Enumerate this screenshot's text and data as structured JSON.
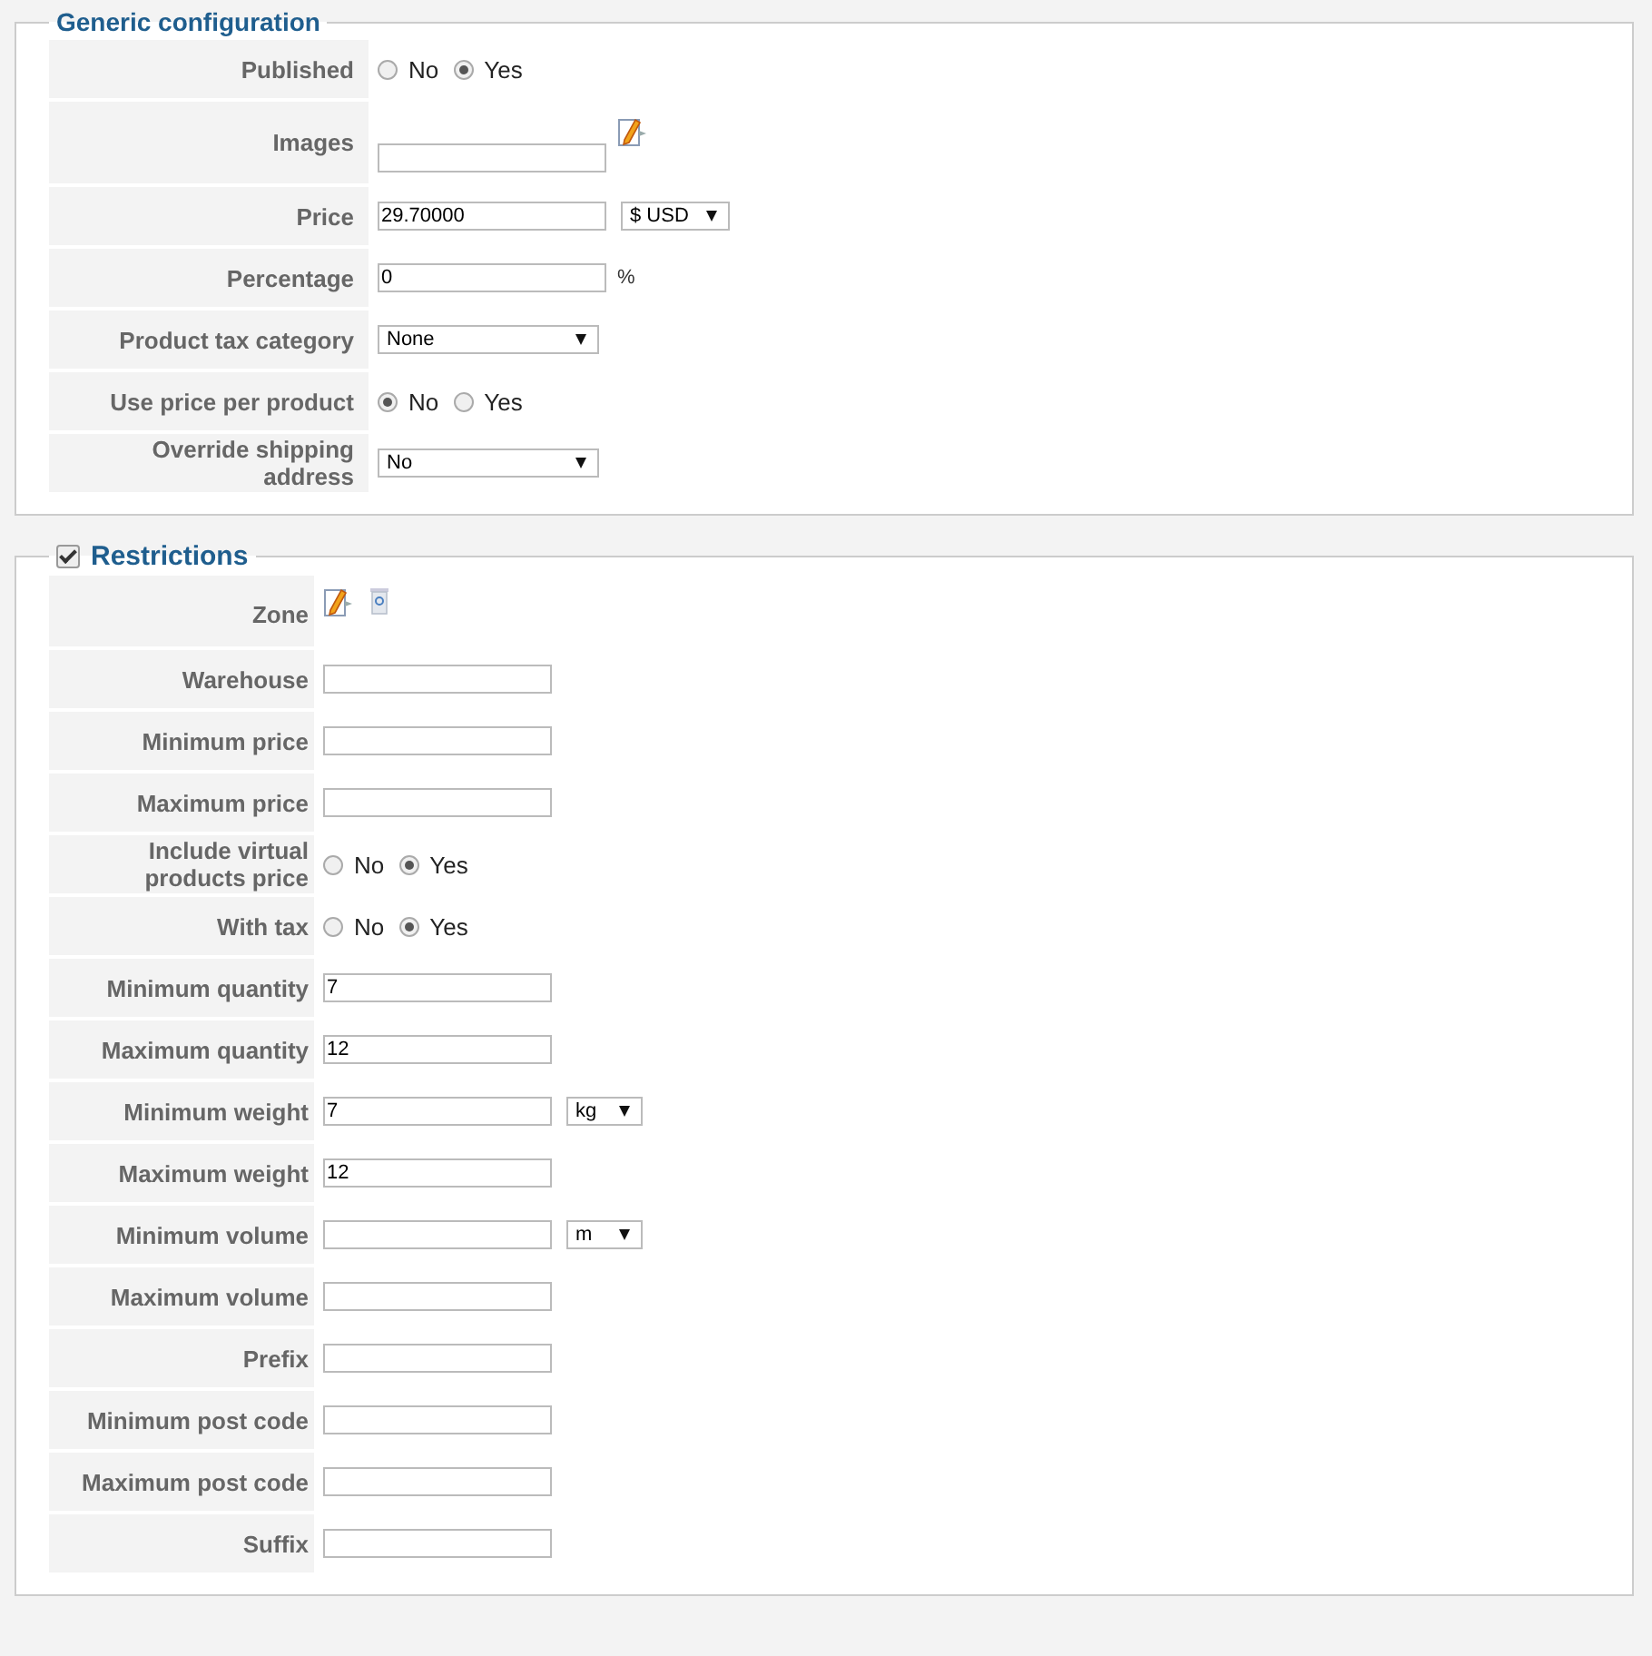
{
  "sections": [
    {
      "title": "Generic configuration",
      "fields": [
        {
          "kind": "radio",
          "label": "Published",
          "options": [
            {
              "label": "No",
              "selected": false
            },
            {
              "label": "Yes",
              "selected": true
            }
          ]
        },
        {
          "kind": "image_input",
          "label": "Images"
        },
        {
          "kind": "input",
          "label": "Price",
          "value": "29.70000",
          "select": "$ USD"
        },
        {
          "kind": "input",
          "label": "Percentage",
          "value": "0",
          "suffix": "%"
        },
        {
          "kind": "select",
          "label": "Product tax category",
          "value": "None"
        },
        {
          "kind": "radio",
          "label": "Use price per product",
          "options": [
            {
              "label": "No",
              "selected": true
            },
            {
              "label": "Yes",
              "selected": false
            }
          ]
        },
        {
          "kind": "select",
          "label": "Override shipping address",
          "value": "No"
        }
      ]
    },
    {
      "title": "Restrictions",
      "checked": true,
      "fields": [
        {
          "kind": "zone",
          "label": "Zone"
        },
        {
          "kind": "input",
          "label": "Warehouse"
        },
        {
          "kind": "input",
          "label": "Minimum price"
        },
        {
          "kind": "input",
          "label": "Maximum price"
        },
        {
          "kind": "radio",
          "label": "Include virtual products price",
          "options": [
            {
              "label": "No",
              "selected": false
            },
            {
              "label": "Yes",
              "selected": true
            }
          ]
        },
        {
          "kind": "radio",
          "label": "With tax",
          "options": [
            {
              "label": "No",
              "selected": false
            },
            {
              "label": "Yes",
              "selected": true
            }
          ]
        },
        {
          "kind": "input",
          "label": "Minimum quantity",
          "value": "7"
        },
        {
          "kind": "input",
          "label": "Maximum quantity",
          "value": "12"
        },
        {
          "kind": "input",
          "label": "Minimum weight",
          "value": "7",
          "select": "kg"
        },
        {
          "kind": "input",
          "label": "Maximum weight",
          "value": "12"
        },
        {
          "kind": "input",
          "label": "Minimum volume",
          "select": "m"
        },
        {
          "kind": "input",
          "label": "Maximum volume"
        },
        {
          "kind": "input",
          "label": "Prefix"
        },
        {
          "kind": "input",
          "label": "Minimum post code"
        },
        {
          "kind": "input",
          "label": "Maximum post code"
        },
        {
          "kind": "input",
          "label": "Suffix"
        }
      ]
    }
  ]
}
